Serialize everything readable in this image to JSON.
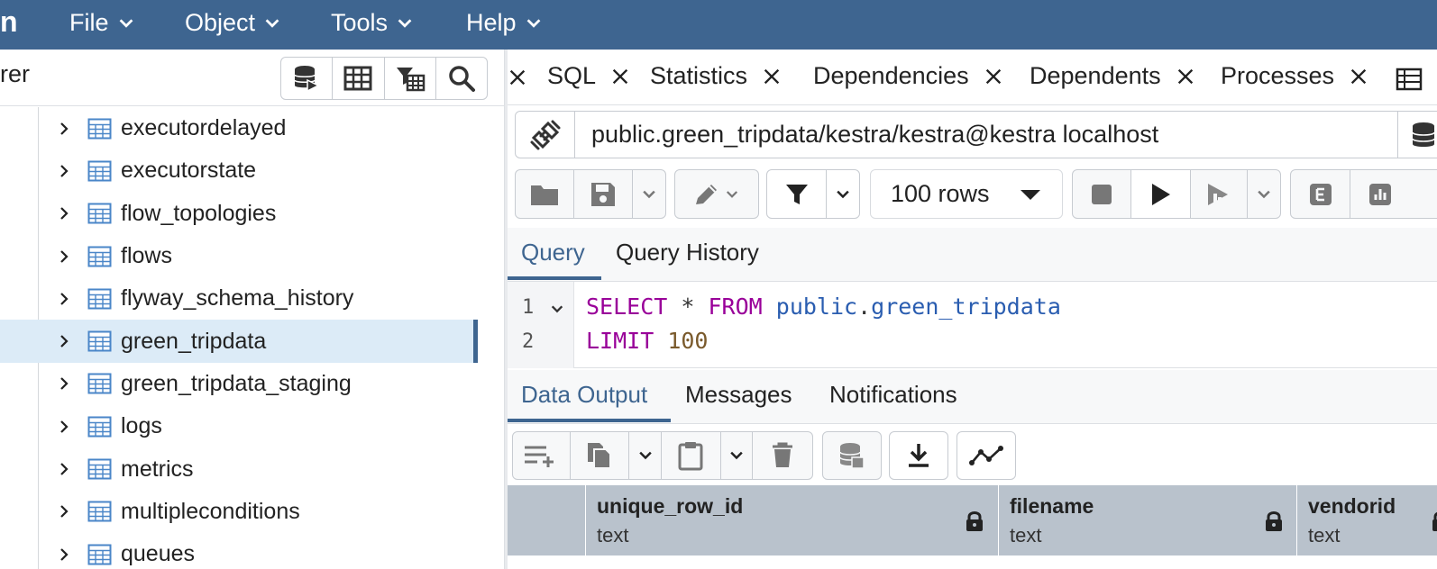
{
  "menubar": {
    "brand": "n",
    "menus": [
      "File",
      "Object",
      "Tools",
      "Help"
    ]
  },
  "browser": {
    "title_fragment": "rer",
    "tree": [
      {
        "label": "executordelayed",
        "selected": false
      },
      {
        "label": "executorstate",
        "selected": false
      },
      {
        "label": "flow_topologies",
        "selected": false
      },
      {
        "label": "flows",
        "selected": false
      },
      {
        "label": "flyway_schema_history",
        "selected": false
      },
      {
        "label": "green_tripdata",
        "selected": true
      },
      {
        "label": "green_tripdata_staging",
        "selected": false
      },
      {
        "label": "logs",
        "selected": false
      },
      {
        "label": "metrics",
        "selected": false
      },
      {
        "label": "multipleconditions",
        "selected": false
      },
      {
        "label": "queues",
        "selected": false
      }
    ]
  },
  "tabs": [
    "SQL",
    "Statistics",
    "Dependencies",
    "Dependents",
    "Processes"
  ],
  "connection": {
    "value": "public.green_tripdata/kestra/kestra@kestra localhost"
  },
  "toolbar": {
    "rows_limit": "100 rows"
  },
  "query_tabs": {
    "query": "Query",
    "history": "Query History"
  },
  "editor": {
    "line1_no": "1",
    "line2_no": "2",
    "select_kw": "SELECT",
    "star": "*",
    "from_kw": "FROM",
    "schema": "public",
    "dot": ".",
    "table": "green_tripdata",
    "limit_kw": "LIMIT",
    "limit_val": "100"
  },
  "output_tabs": {
    "data_output": "Data Output",
    "messages": "Messages",
    "notifications": "Notifications"
  },
  "grid": {
    "columns": [
      {
        "name": "unique_row_id",
        "type": "text"
      },
      {
        "name": "filename",
        "type": "text"
      },
      {
        "name": "vendorid",
        "type": "text"
      }
    ]
  },
  "colors": {
    "header_bg": "#3e6590",
    "selection_bg": "#dcebf7",
    "keyword": "#990099",
    "identifier": "#2a5db0",
    "number": "#7a5a2c"
  }
}
